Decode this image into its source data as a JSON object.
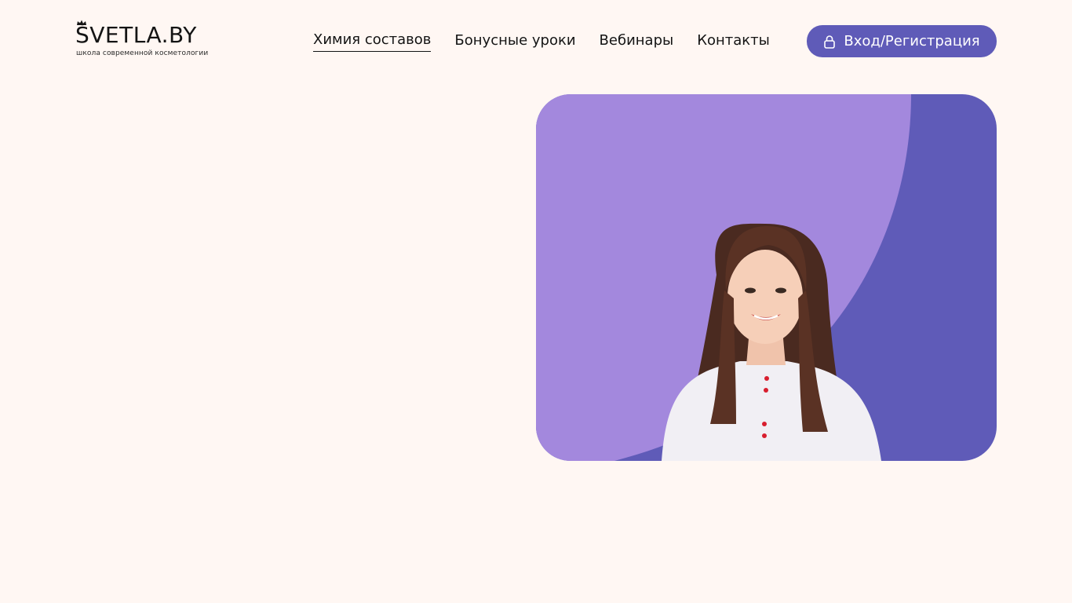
{
  "header": {
    "logo": {
      "title": "ŠVETLA.BY",
      "subtitle": "школа современной косметологии"
    },
    "nav": {
      "items": [
        {
          "label": "Химия составов",
          "active": true
        },
        {
          "label": "Бонусные уроки",
          "active": false
        },
        {
          "label": "Вебинары",
          "active": false
        },
        {
          "label": "Контакты",
          "active": false
        }
      ]
    },
    "login_button": {
      "label": "Вход/Регистрация",
      "icon": "lock-icon"
    }
  },
  "hero": {
    "image": "portrait-photo-woman-in-white-coat"
  },
  "colors": {
    "background": "#fff7f3",
    "accent": "#5f5bb8",
    "light_accent": "#a388dd",
    "text": "#141414"
  }
}
